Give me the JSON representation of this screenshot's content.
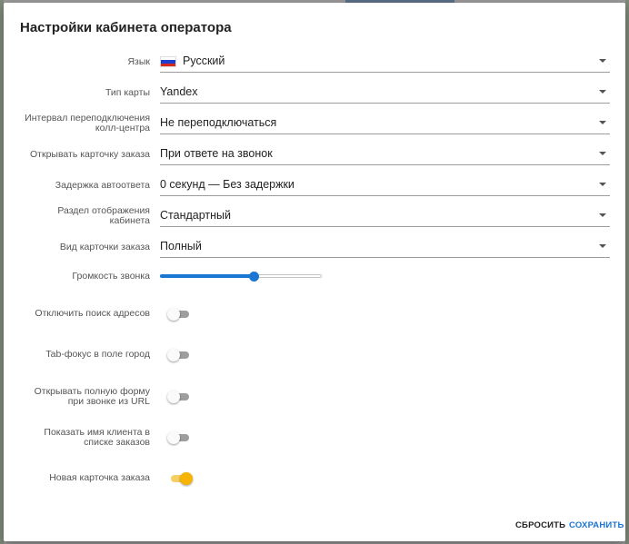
{
  "dialog": {
    "title": "Настройки кабинета оператора",
    "reset_label": "СБРОСИТЬ",
    "save_label": "СОХРАНИТЬ"
  },
  "colors": {
    "accent": "#1976d2",
    "toggle_on": "#f6b400"
  },
  "settings": {
    "language": {
      "label": "Язык",
      "value": "Русский",
      "icon": "russian-flag-icon"
    },
    "map_type": {
      "label": "Тип карты",
      "value": "Yandex"
    },
    "reconnect_interval": {
      "label_line1": "Интервал переподключения",
      "label_line2": "колл-центра",
      "value": "Не переподключаться"
    },
    "open_order_card": {
      "label": "Открывать карточку заказа",
      "value": "При ответе на звонок"
    },
    "autoanswer_delay": {
      "label": "Задержка автоответа",
      "value": "0 секунд — Без задержки"
    },
    "display_section": {
      "label_line1": "Раздел отображения",
      "label_line2": "кабинета",
      "value": "Стандартный"
    },
    "card_view": {
      "label": "Вид карточки заказа",
      "value": "Полный"
    },
    "ring_volume": {
      "label": "Громкость звонка",
      "value": 0.58
    }
  },
  "toggles": [
    {
      "label_line1": "Отключить поиск адресов",
      "label_line2": "",
      "on": false
    },
    {
      "label_line1": "Tab-фокус в поле город",
      "label_line2": "",
      "on": false
    },
    {
      "label_line1": "Открывать полную форму",
      "label_line2": "при звонке из URL",
      "on": false
    },
    {
      "label_line1": "Показать имя клиента в",
      "label_line2": "списке заказов",
      "on": false
    },
    {
      "label_line1": "Новая карточка заказа",
      "label_line2": "",
      "on": true
    }
  ]
}
